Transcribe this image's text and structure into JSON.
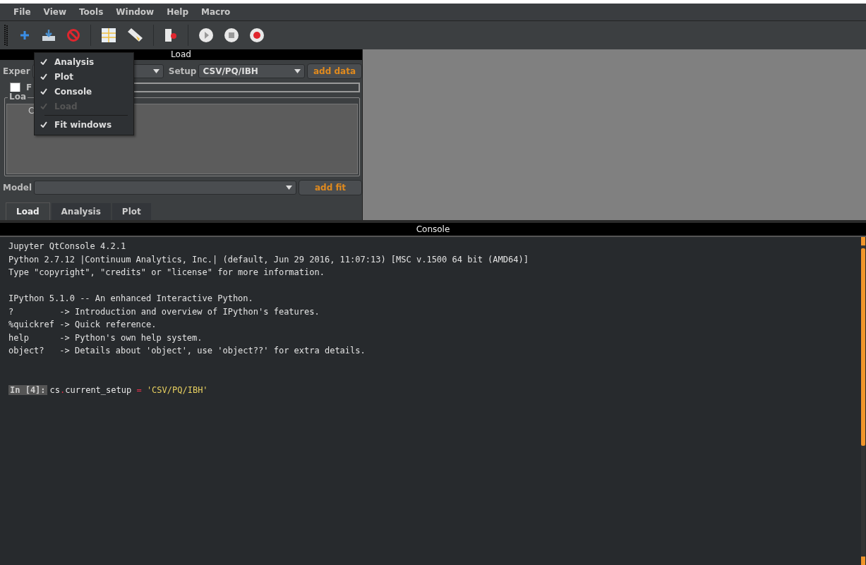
{
  "menu_bar": [
    "File",
    "View",
    "Tools",
    "Window",
    "Help",
    "Macro"
  ],
  "load_panel": {
    "title": "Load",
    "experiment_label": "Exper",
    "setup_label": "Setup",
    "setup_value": "CSV/PQ/IBH",
    "add_data": "add data",
    "checkbox": {
      "label": "F",
      "checked": false
    },
    "group_title": "Loa",
    "list_item": "C",
    "model_label": "Model",
    "add_fit": "add fit"
  },
  "tabs": [
    {
      "label": "Load",
      "selected": true
    },
    {
      "label": "Analysis",
      "selected": false
    },
    {
      "label": "Plot",
      "selected": false
    }
  ],
  "window_menu": [
    {
      "label": "Analysis",
      "checked": true,
      "disabled": false
    },
    {
      "label": "Plot",
      "checked": true,
      "disabled": false
    },
    {
      "label": "Console",
      "checked": true,
      "disabled": false
    },
    {
      "label": "Load",
      "checked": true,
      "disabled": true
    },
    {
      "label": "Fit windows",
      "checked": true,
      "disabled": false,
      "separator_before": true
    }
  ],
  "console": {
    "title": "Console",
    "lines": [
      "Jupyter QtConsole 4.2.1",
      "Python 2.7.12 |Continuum Analytics, Inc.| (default, Jun 29 2016, 11:07:13) [MSC v.1500 64 bit (AMD64)]",
      "Type \"copyright\", \"credits\" or \"license\" for more information.",
      "IPython 5.1.0 -- An enhanced Interactive Python.",
      "?         -> Introduction and overview of IPython's features.",
      "%quickref -> Quick reference.",
      "help      -> Python's own help system.",
      "object?   -> Details about 'object', use 'object??' for extra details."
    ],
    "prompt": "In [4]:",
    "code": [
      {
        "text": "cs",
        "kind": "name"
      },
      {
        "text": ".",
        "kind": "op"
      },
      {
        "text": "current_setup ",
        "kind": "name"
      },
      {
        "text": "=",
        "kind": "op"
      },
      {
        "text": " 'CSV/PQ/IBH'",
        "kind": "string"
      }
    ]
  }
}
